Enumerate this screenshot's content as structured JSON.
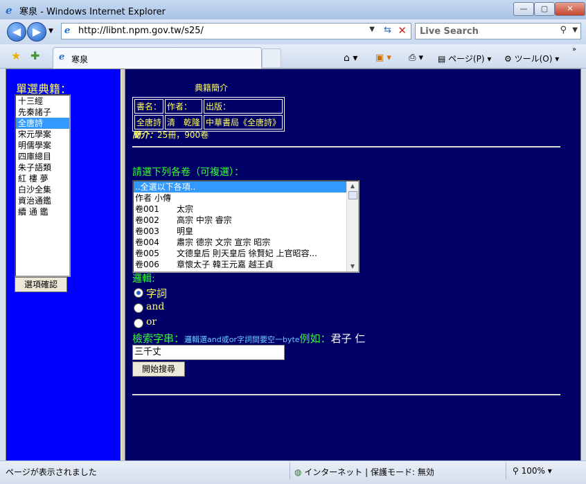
{
  "window": {
    "title": "寒泉 - Windows Internet Explorer",
    "min": "—",
    "max": "▢",
    "close": "✕"
  },
  "addressbar": {
    "url": "http://libnt.npm.gov.tw/s25/",
    "search_placeholder": "Live Search"
  },
  "tab": {
    "title": "寒泉"
  },
  "toolbar": {
    "page_label": "ページ(P)",
    "tools_label": "ツール(O)"
  },
  "left": {
    "title": "單選典籍：",
    "books": [
      "十三經",
      "先秦諸子",
      "全唐詩",
      "宋元學案",
      "明儒學案",
      "四庫總目",
      "朱子語類",
      "紅 樓 夢",
      "白沙全集",
      "資治通鑑",
      "續 通 鑑"
    ],
    "selected_index": 2,
    "confirm_label": "選項確認"
  },
  "intro": {
    "title": "典籍簡介",
    "headers": [
      "書名：",
      "作者：",
      "出版："
    ],
    "values": [
      "全唐詩",
      "清　乾隆",
      "中華書局《全唐詩》"
    ],
    "summary_label": "簡介：",
    "summary_text": "25冊，900卷"
  },
  "volumes": {
    "label": "請選下列各卷（可複選）：",
    "items": [
      {
        "num": "..全選以下各項..",
        "name": ""
      },
      {
        "num": "作者 小傳",
        "name": ""
      },
      {
        "num": "卷001",
        "name": "太宗"
      },
      {
        "num": "卷002",
        "name": "高宗 中宗 睿宗"
      },
      {
        "num": "卷003",
        "name": "明皇"
      },
      {
        "num": "卷004",
        "name": "肅宗 德宗 文宗 宣宗 昭宗"
      },
      {
        "num": "卷005",
        "name": "文德皇后 則天皇后 徐賢妃 上官昭容..."
      },
      {
        "num": "卷006",
        "name": "章懷太子 韓王元嘉 越王貞"
      }
    ],
    "selected_index": 0
  },
  "logic": {
    "label": "邏輯:",
    "options": [
      "字詞",
      "and",
      "or"
    ],
    "selected_index": 0
  },
  "query": {
    "label": "檢索字串：",
    "hint": "邏輯選and或or字詞間要空一byte",
    "example_prefix": "例如：",
    "example": "君子 仁",
    "value": "三千丈",
    "start_label": "開始搜尋"
  },
  "status": {
    "message": "ページが表示されました",
    "zone": "インターネット | 保護モード: 無効",
    "zoom": "100%"
  }
}
